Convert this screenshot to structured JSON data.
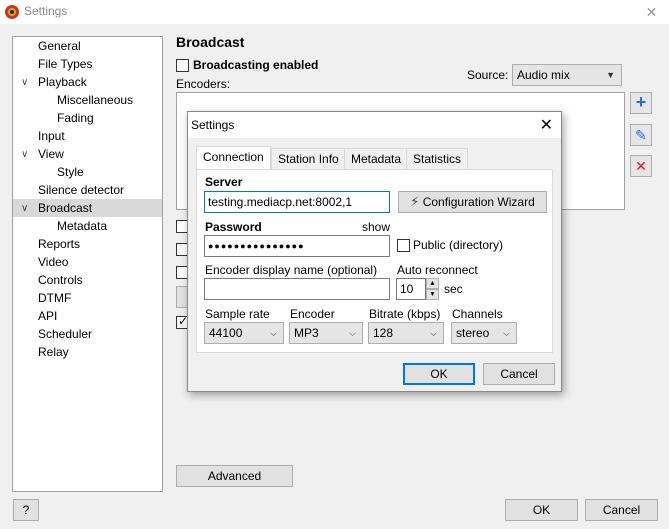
{
  "window": {
    "title": "Settings",
    "close_glyph": "✕"
  },
  "tree": {
    "items": [
      {
        "label": "General"
      },
      {
        "label": "File Types"
      },
      {
        "label": "Playback"
      },
      {
        "label": "Miscellaneous"
      },
      {
        "label": "Fading"
      },
      {
        "label": "Input"
      },
      {
        "label": "View"
      },
      {
        "label": "Style"
      },
      {
        "label": "Silence detector"
      },
      {
        "label": "Broadcast"
      },
      {
        "label": "Metadata"
      },
      {
        "label": "Reports"
      },
      {
        "label": "Video"
      },
      {
        "label": "Controls"
      },
      {
        "label": "DTMF"
      },
      {
        "label": "API"
      },
      {
        "label": "Scheduler"
      },
      {
        "label": "Relay"
      }
    ],
    "selected": "Broadcast"
  },
  "broadcast": {
    "title": "Broadcast",
    "enabled_label": "Broadcasting enabled",
    "enabled_checked": false,
    "encoders_label": "Encoders:",
    "source_label": "Source:",
    "source_value": "Audio mix",
    "advanced_label": "Advanced"
  },
  "side_buttons": {
    "add_glyph": "+",
    "edit_glyph": "✎",
    "delete_glyph": "✕"
  },
  "footer": {
    "help_label": "?",
    "ok_label": "OK",
    "cancel_label": "Cancel"
  },
  "dialog": {
    "title": "Settings",
    "close_glyph": "✕",
    "tabs": [
      {
        "label": "Connection"
      },
      {
        "label": "Station Info"
      },
      {
        "label": "Metadata"
      },
      {
        "label": "Statistics"
      }
    ],
    "active_tab": "Connection",
    "server_label": "Server",
    "server_value": "testing.mediacp.net:8002,1",
    "wizard_label": "Configuration Wizard",
    "password_label": "Password",
    "show_label": "show",
    "password_value": "●●●●●●●●●●●●●●●",
    "public_label": "Public (directory)",
    "public_checked": false,
    "display_name_label": "Encoder display name (optional)",
    "display_name_value": "",
    "auto_reconnect_label": "Auto reconnect",
    "auto_reconnect_value": "10",
    "auto_reconnect_unit": "sec",
    "sample_rate_label": "Sample rate",
    "sample_rate_value": "44100",
    "encoder_label": "Encoder",
    "encoder_value": "MP3",
    "bitrate_label": "Bitrate (kbps)",
    "bitrate_value": "128",
    "channels_label": "Channels",
    "channels_value": "stereo",
    "ok_label": "OK",
    "cancel_label": "Cancel"
  },
  "colors": {
    "accent": "#0078d7",
    "delete_red": "#e81123",
    "add_blue": "#1e6fd9",
    "selection": "#d9d9d9"
  }
}
